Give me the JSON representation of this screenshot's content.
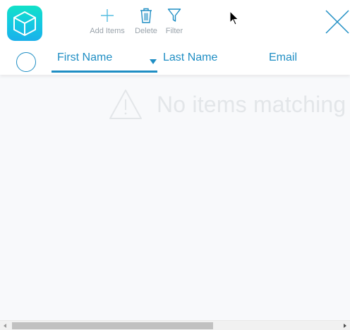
{
  "toolbar": {
    "app_icon": "cube-icon",
    "add_label": "Add Items",
    "delete_label": "Delete",
    "filter_label": "Filter",
    "close_icon": "close-icon"
  },
  "columns": [
    {
      "label": "First Name",
      "sorted": "descending"
    },
    {
      "label": "Last Name"
    },
    {
      "label": "Email"
    }
  ],
  "empty_state": {
    "icon": "warning-icon",
    "message": "No items matching"
  },
  "colors": {
    "accent": "#1f8ec4",
    "app_icon_top": "#11e1c7",
    "app_icon_bottom": "#1ab0ea",
    "muted_text": "#e3e6e9"
  },
  "scrollbar": {
    "position_fraction": 0.0,
    "visible_fraction": 0.6
  }
}
